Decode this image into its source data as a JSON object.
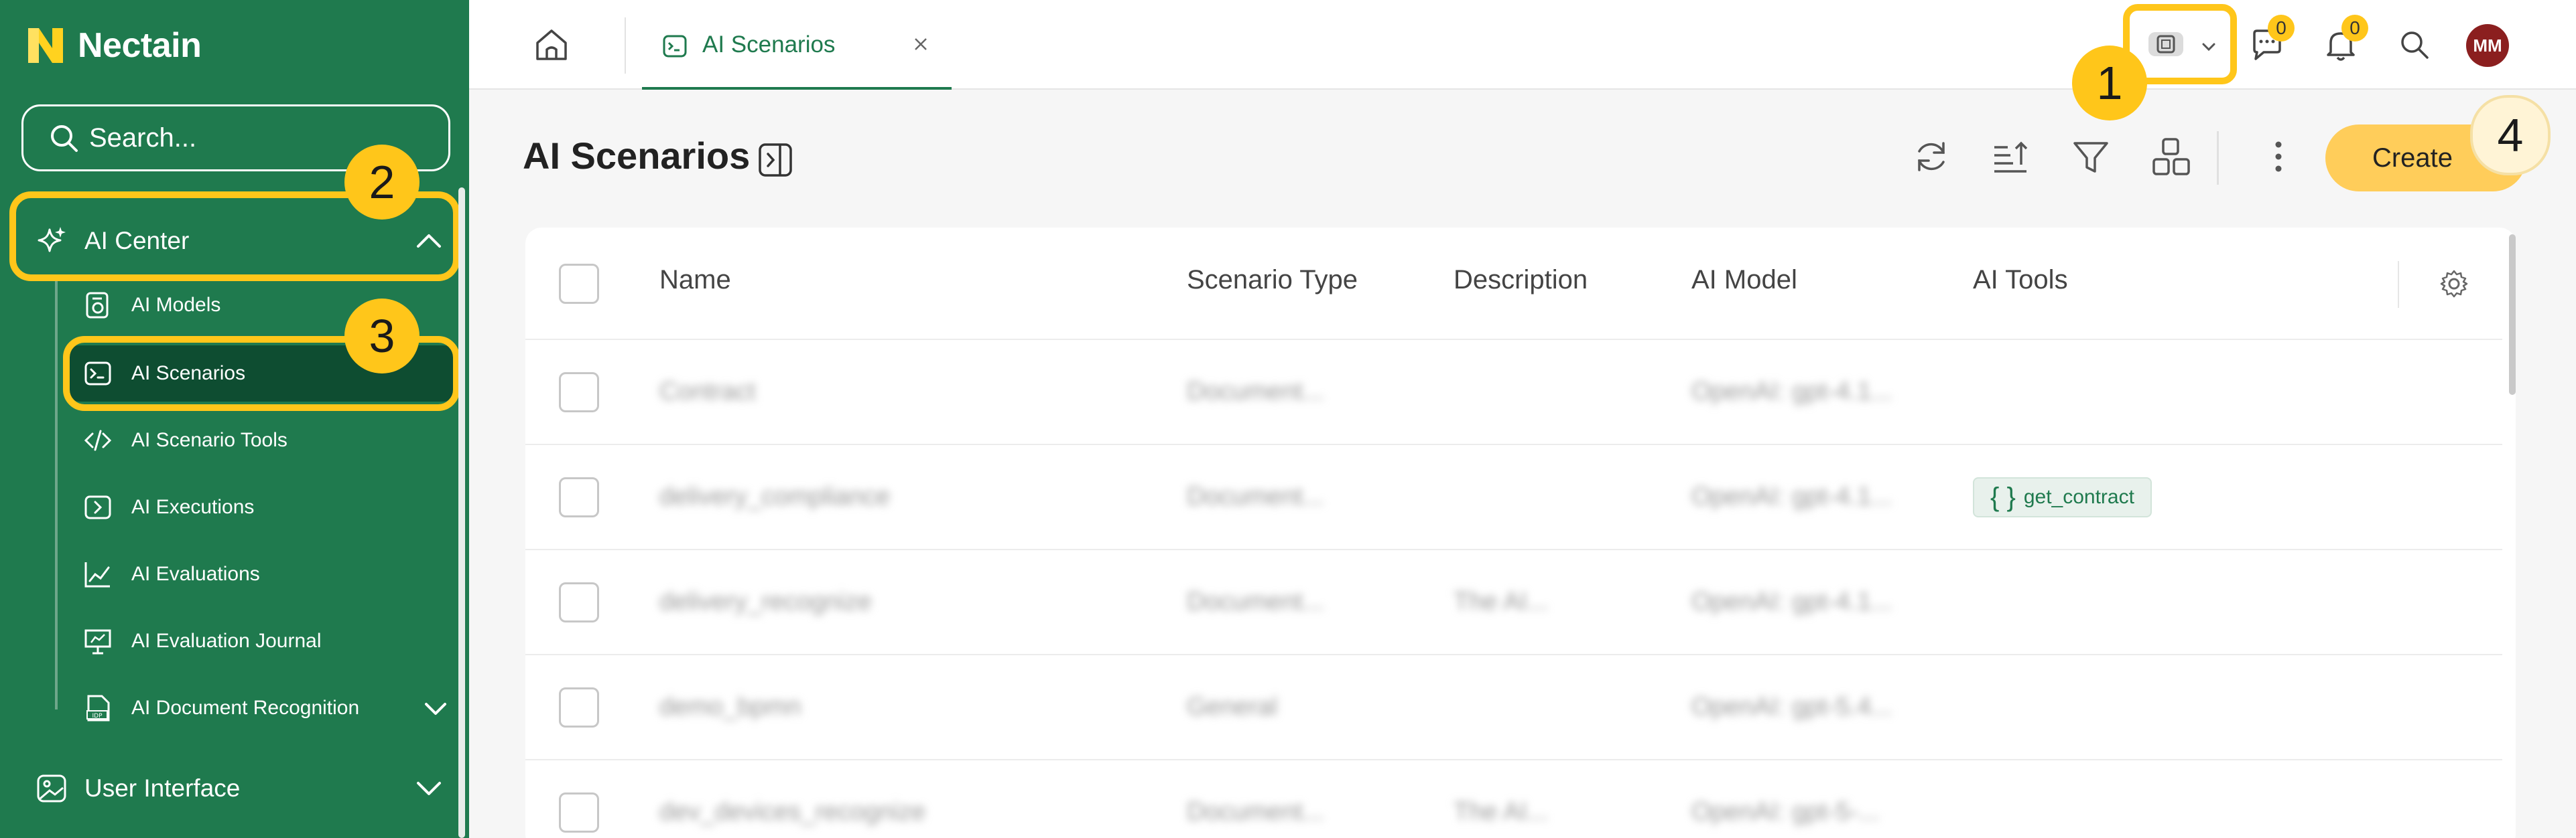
{
  "app": {
    "brand": "Nectain",
    "search_placeholder": "Search..."
  },
  "sidebar": {
    "groups": [
      {
        "label": "AI Center",
        "icon": "sparkle-icon",
        "expanded": true
      },
      {
        "label": "User Interface",
        "icon": "image-icon",
        "expanded": false
      }
    ],
    "items": [
      {
        "label": "AI Models",
        "icon": "model-icon"
      },
      {
        "label": "AI Scenarios",
        "icon": "terminal-icon",
        "active": true
      },
      {
        "label": "AI Scenario Tools",
        "icon": "code-icon"
      },
      {
        "label": "AI Executions",
        "icon": "execution-icon"
      },
      {
        "label": "AI Evaluations",
        "icon": "line-chart-icon"
      },
      {
        "label": "AI Evaluation Journal",
        "icon": "presentation-icon"
      },
      {
        "label": "AI Document Recognition",
        "icon": "idp-document-icon"
      }
    ]
  },
  "topbar": {
    "tab_label": "AI Scenarios",
    "chat_count": "0",
    "notification_count": "0",
    "avatar_initials": "MM"
  },
  "page": {
    "title": "AI Scenarios",
    "create_label": "Create"
  },
  "table": {
    "columns": [
      "Name",
      "Scenario Type",
      "Description",
      "AI Model",
      "AI Tools"
    ],
    "rows": [
      {
        "name": "Contract",
        "type": "Document...",
        "description": "",
        "model": "OpenAI: gpt-4.1...",
        "tools": ""
      },
      {
        "name": "delivery_compliance",
        "type": "Document...",
        "description": "",
        "model": "OpenAI: gpt-4.1...",
        "tools": "get_contract"
      },
      {
        "name": "delivery_recognize",
        "type": "Document...",
        "description": "The AI...",
        "model": "OpenAI: gpt-4.1...",
        "tools": ""
      },
      {
        "name": "demo_bpmn",
        "type": "General",
        "description": "",
        "model": "OpenAI: gpt-5.4...",
        "tools": ""
      },
      {
        "name": "dev_devices_recognize",
        "type": "Document...",
        "description": "The AI...",
        "model": "OpenAI: gpt-5-...",
        "tools": ""
      }
    ]
  },
  "callouts": [
    "1",
    "2",
    "3",
    "4"
  ],
  "colors": {
    "brand_green": "#1f7a4e",
    "active_item": "#0e4d31",
    "highlight_yellow": "#ffc61a",
    "create_button": "#ffcd5a"
  }
}
